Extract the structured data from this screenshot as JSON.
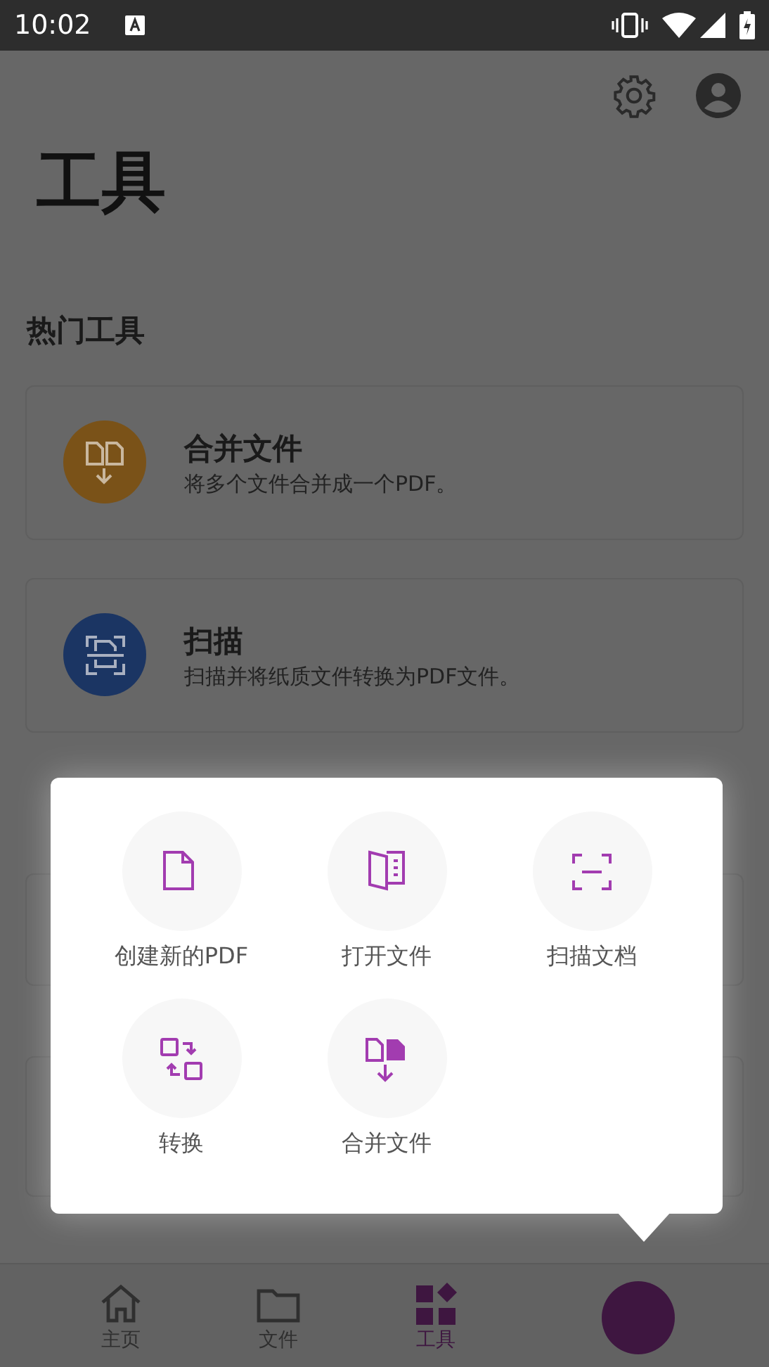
{
  "status_bar": {
    "time": "10:02"
  },
  "title": "工具",
  "section": {
    "heading": "热门工具"
  },
  "tools": [
    {
      "title": "合并文件",
      "description": "将多个文件合并成一个PDF。",
      "kind": "merge",
      "color": "#7a5218"
    },
    {
      "title": "扫描",
      "description": "扫描并将纸质文件转换为PDF文件。",
      "kind": "scan",
      "color": "#1b3563"
    }
  ],
  "popup": {
    "items": [
      {
        "label": "创建新的PDF",
        "kind": "new"
      },
      {
        "label": "打开文件",
        "kind": "open"
      },
      {
        "label": "扫描文档",
        "kind": "scan"
      },
      {
        "label": "转换",
        "kind": "convert"
      },
      {
        "label": "合并文件",
        "kind": "merge"
      }
    ]
  },
  "nav": [
    {
      "label": "主页",
      "kind": "home",
      "selected": false
    },
    {
      "label": "文件",
      "kind": "files",
      "selected": false
    },
    {
      "label": "工具",
      "kind": "tools",
      "selected": true
    }
  ]
}
